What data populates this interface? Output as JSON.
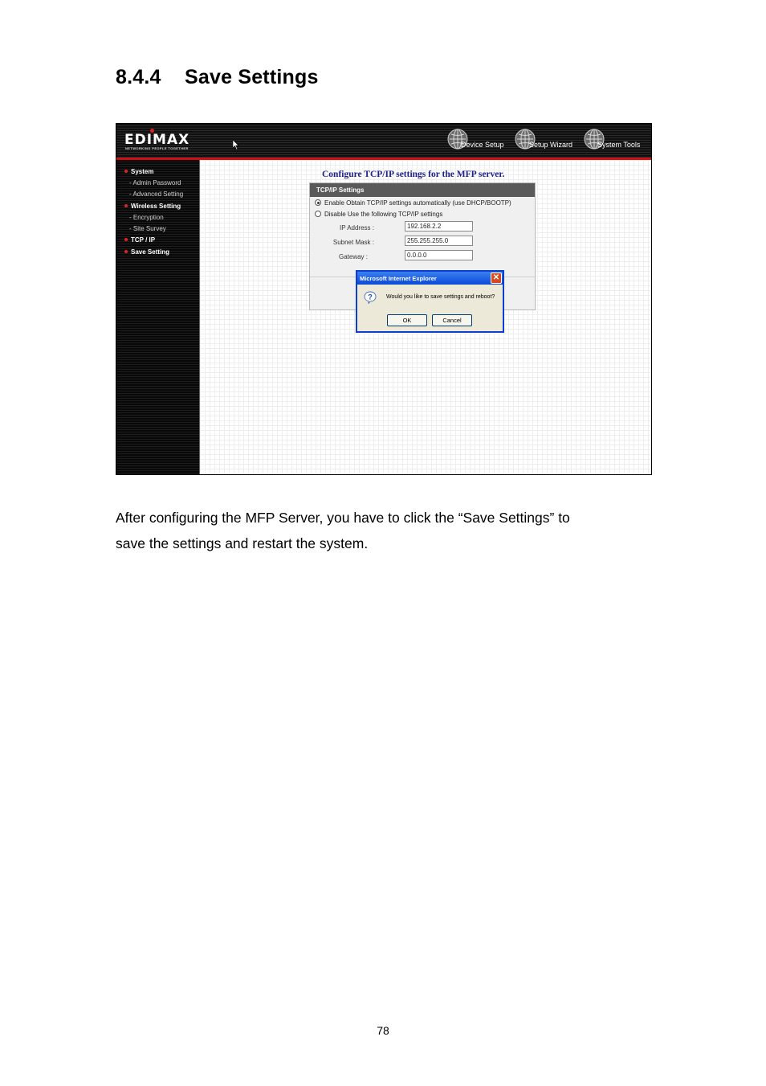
{
  "heading": {
    "number": "8.4.4",
    "title": "Save Settings"
  },
  "screenshot": {
    "logo": {
      "text": "EDIMAX",
      "tagline": "NETWORKING PEOPLE TOGETHER"
    },
    "nav": [
      {
        "label": "Device Setup",
        "icon": "globe-icon"
      },
      {
        "label": "Setup Wizard",
        "icon": "globe-icon"
      },
      {
        "label": "System Tools",
        "icon": "globe-icon"
      }
    ],
    "sidebar": [
      {
        "label": "System",
        "kind": "main"
      },
      {
        "label": "- Admin Password",
        "kind": "sub"
      },
      {
        "label": "- Advanced Setting",
        "kind": "sub"
      },
      {
        "label": "Wireless Setting",
        "kind": "main"
      },
      {
        "label": "- Encryption",
        "kind": "sub"
      },
      {
        "label": "- Site Survey",
        "kind": "sub"
      },
      {
        "label": "TCP / IP",
        "kind": "main"
      },
      {
        "label": "Save Setting",
        "kind": "main"
      }
    ],
    "config_title": "Configure TCP/IP settings for the MFP server.",
    "panel": {
      "header": "TCP/IP Settings",
      "option_auto": "Enable Obtain TCP/IP settings automatically (use DHCP/BOOTP)",
      "option_manual": "Disable Use the following TCP/IP settings",
      "selected_option": "auto",
      "fields": [
        {
          "label": "IP Address :",
          "value": "192.168.2.2"
        },
        {
          "label": "Subnet Mask :",
          "value": "255.255.255.0"
        },
        {
          "label": "Gateway :",
          "value": "0.0.0.0"
        }
      ]
    },
    "dialog": {
      "title": "Microsoft Internet Explorer",
      "close_label": "✕",
      "message": "Would you like to save settings and reboot?",
      "ok_label": "OK",
      "cancel_label": "Cancel",
      "icon": "question-icon"
    }
  },
  "body": {
    "line1": "After configuring the MFP Server, you have to click the “Save Settings” to",
    "line2": "save the settings and restart the system."
  },
  "page_number": "78",
  "colors": {
    "accent_red": "#d01010",
    "dialog_blue": "#0a48d8",
    "title_blue": "#1a1f8a"
  }
}
